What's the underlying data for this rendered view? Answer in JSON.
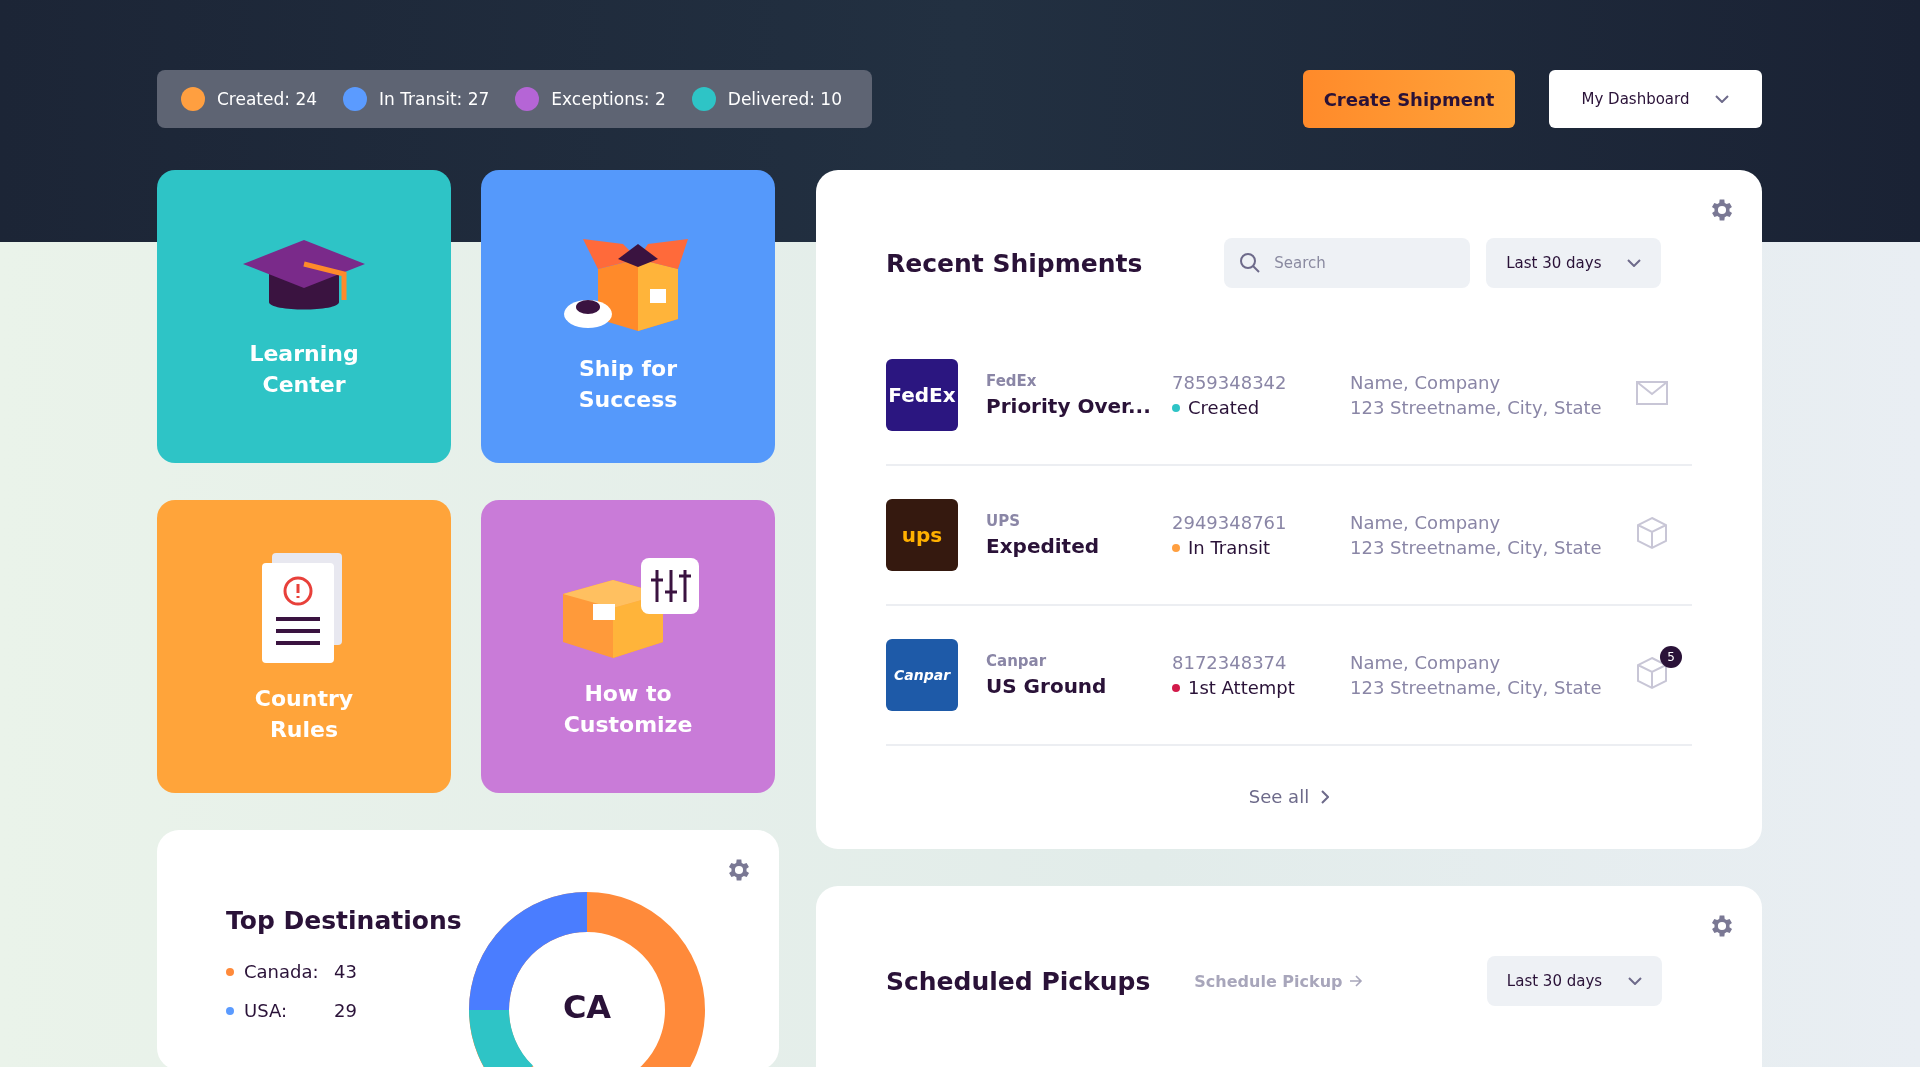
{
  "stats": [
    {
      "label": "Created: 24",
      "color": "#ff9f40"
    },
    {
      "label": "In Transit: 27",
      "color": "#5b9bff"
    },
    {
      "label": "Exceptions: 2",
      "color": "#b565d6"
    },
    {
      "label": "Delivered: 10",
      "color": "#2ec4c6"
    }
  ],
  "actions": {
    "create": "Create Shipment",
    "dashboard": "My Dashboard"
  },
  "tiles": [
    {
      "kind": "learning",
      "label": "Learning\nCenter",
      "color": "#2ec4c6"
    },
    {
      "kind": "ship",
      "label": "Ship for\nSuccess",
      "color": "#5599fb"
    },
    {
      "kind": "rules",
      "label": "Country\nRules",
      "color": "#ffa43a"
    },
    {
      "kind": "customize",
      "label": "How to\nCustomize",
      "color": "#c97bd8"
    }
  ],
  "recent_shipments": {
    "title": "Recent Shipments",
    "search": {
      "placeholder": "Search"
    },
    "period": "Last 30 days",
    "see_all": "See all",
    "rows": [
      {
        "kind": "fedex",
        "logo_text": "FedEx",
        "carrier": "FedEx",
        "service": "Priority Over...",
        "tracking": "7859348342",
        "status": "Created",
        "color": "#2ec4c6",
        "recipient": "Name, Company",
        "address": "123 Streetname, City, State"
      },
      {
        "kind": "ups",
        "logo_text": "ups",
        "carrier": "UPS",
        "service": "Expedited",
        "tracking": "2949348761",
        "status": "In Transit",
        "color": "#ff9f40",
        "recipient": "Name, Company",
        "address": "123 Streetname, City, State"
      },
      {
        "kind": "canpar",
        "logo_text": "Canpar",
        "carrier": "Canpar",
        "service": "US Ground",
        "tracking": "8172348374",
        "status": "1st Attempt",
        "color": "#d21a4a",
        "recipient": "Name, Company",
        "address": "123 Streetname, City, State",
        "badge": "5"
      }
    ]
  },
  "top_destinations": {
    "title": "Top Destinations",
    "center_label": "CA",
    "items": [
      {
        "name": "Canada:",
        "value": "43",
        "color": "#ff8a3a"
      },
      {
        "name": "USA:",
        "value": "29",
        "color": "#5b9bff"
      }
    ]
  },
  "scheduled_pickups": {
    "title": "Scheduled Pickups",
    "link": "Schedule Pickup",
    "period": "Last 30 days"
  }
}
